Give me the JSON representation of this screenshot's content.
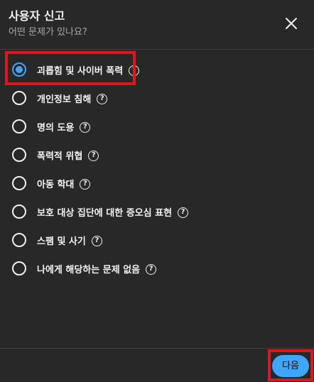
{
  "dialog": {
    "title": "사용자 신고",
    "subtitle": "어떤 문제가 있나요?",
    "close_icon": "close-icon"
  },
  "options": [
    {
      "label": "괴롭힘 및 사이버 폭력",
      "selected": true,
      "help_glyph": "?"
    },
    {
      "label": "개인정보 침해",
      "selected": false,
      "help_glyph": "?"
    },
    {
      "label": "명의 도용",
      "selected": false,
      "help_glyph": "?"
    },
    {
      "label": "폭력적 위협",
      "selected": false,
      "help_glyph": "?"
    },
    {
      "label": "아동 학대",
      "selected": false,
      "help_glyph": "?"
    },
    {
      "label": "보호 대상 집단에 대한 증오심 표현",
      "selected": false,
      "help_glyph": "?"
    },
    {
      "label": "스팸 및 사기",
      "selected": false,
      "help_glyph": "?"
    },
    {
      "label": "나에게 해당하는 문제 없음",
      "selected": false,
      "help_glyph": "?"
    }
  ],
  "footer": {
    "next_label": "다음"
  },
  "colors": {
    "background": "#282828",
    "accent": "#3ea6ff",
    "highlight": "#e0161f"
  }
}
